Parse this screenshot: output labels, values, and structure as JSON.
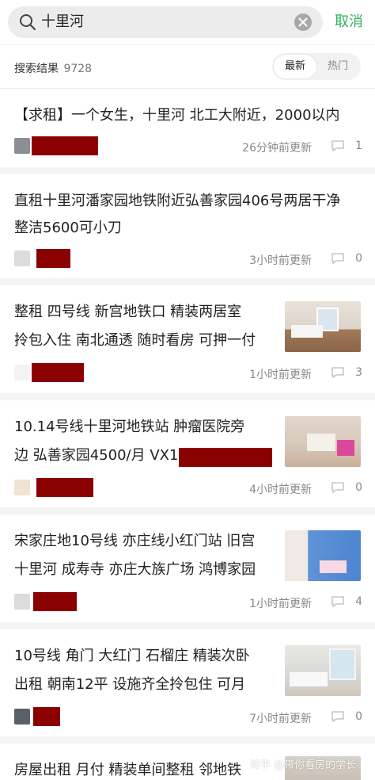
{
  "search": {
    "query": "十里河",
    "cancel_label": "取消"
  },
  "results": {
    "label": "搜索结果",
    "count": "9728"
  },
  "sort": {
    "latest": "最新",
    "hot": "热门"
  },
  "posts": [
    {
      "title_line1": "【求租】一个女生，十里河 北工大附近，2000以内",
      "title_line2": "",
      "time": "26分钟前更新",
      "comments": "1"
    },
    {
      "title_line1": "直租十里河潘家园地铁附近弘善家园406号两居干净",
      "title_line2": "整洁5600可小刀",
      "time": "3小时前更新",
      "comments": "0"
    },
    {
      "title_line1": "整租 四号线 新宫地铁口 精装两居室",
      "title_line2": "拎包入住 南北通透 随时看房 可押一付",
      "time": "1小时前更新",
      "comments": "3"
    },
    {
      "title_line1": "10.14号线十里河地铁站 肿瘤医院旁",
      "title_line2": "边 弘善家园4500/月 VX19",
      "time": "4小时前更新",
      "comments": "0"
    },
    {
      "title_line1": "宋家庄地10号线 亦庄线小红门站 旧宫",
      "title_line2": "十里河 成寿寺 亦庄大族广场 鸿博家园",
      "time": "1小时前更新",
      "comments": "4"
    },
    {
      "title_line1": "10号线 角门 大红门 石榴庄 精装次卧",
      "title_line2": "出租 朝南12平 设施齐全拎包住 可月",
      "time": "7小时前更新",
      "comments": "0"
    },
    {
      "title_line1": "房屋出租 月付 精装单间整租 邻地铁",
      "title_line2": "",
      "time": "",
      "comments": ""
    }
  ],
  "watermark": "知乎 @带你看房的学长",
  "colors": {
    "accent": "#2db35d",
    "redaction": "#8b0000"
  }
}
